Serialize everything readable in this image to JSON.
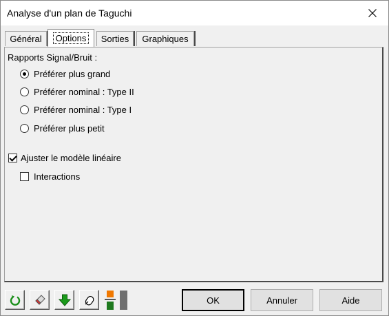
{
  "window": {
    "title": "Analyse d'un plan de Taguchi"
  },
  "icons": {
    "close": "close-icon"
  },
  "tabs": [
    {
      "label": "Général",
      "active": false
    },
    {
      "label": "Options",
      "active": true
    },
    {
      "label": "Sorties",
      "active": false
    },
    {
      "label": "Graphiques",
      "active": false
    }
  ],
  "options": {
    "group_label": "Rapports Signal/Bruit :",
    "radios": [
      {
        "label": "Préférer plus grand",
        "selected": true
      },
      {
        "label": "Préférer nominal : Type II",
        "selected": false
      },
      {
        "label": "Préférer nominal : Type I",
        "selected": false
      },
      {
        "label": "Préférer plus petit",
        "selected": false
      }
    ],
    "fit_linear_model": {
      "label": "Ajuster le modèle linéaire",
      "checked": true
    },
    "interactions": {
      "label": "Interactions",
      "checked": false
    }
  },
  "toolbar": {
    "tools": [
      "reset-icon",
      "eraser-icon",
      "down-arrow-icon",
      "mouse-icon",
      "color-toggle-icon"
    ]
  },
  "buttons": {
    "ok": "OK",
    "cancel": "Annuler",
    "help": "Aide"
  },
  "colors": {
    "accent_green": "#1a8f1a",
    "accent_orange": "#f07800",
    "dark_green": "#1f7a1f"
  }
}
